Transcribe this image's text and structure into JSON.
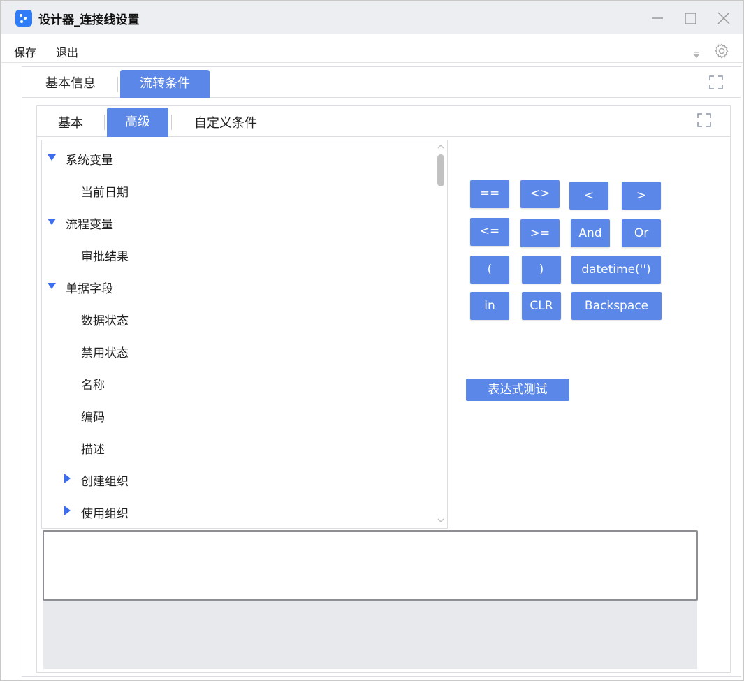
{
  "window": {
    "title": "设计器_连接线设置",
    "controls": [
      "minimize",
      "maximize",
      "close"
    ]
  },
  "menu": {
    "items": [
      "保存",
      "退出"
    ]
  },
  "outer_tabs": [
    {
      "label": "基本信息",
      "active": false
    },
    {
      "label": "流转条件",
      "active": true
    }
  ],
  "inner_tabs": [
    {
      "label": "基本",
      "active": false
    },
    {
      "label": "高级",
      "active": true
    },
    {
      "label": "自定义条件",
      "active": false
    }
  ],
  "tree": {
    "groups": [
      {
        "label": "系统变量",
        "expanded": true,
        "children": [
          "当前日期"
        ]
      },
      {
        "label": "流程变量",
        "expanded": true,
        "children": [
          "审批结果"
        ]
      },
      {
        "label": "单据字段",
        "expanded": true,
        "children": [
          "数据状态",
          "禁用状态",
          "名称",
          "编码",
          "描述"
        ],
        "collapsed_children": [
          "创建组织",
          "使用组织"
        ]
      }
    ]
  },
  "operators": [
    [
      "==",
      "<>",
      "<",
      ">"
    ],
    [
      "<=",
      ">=",
      "And",
      "Or"
    ],
    [
      "(",
      ")",
      "datetime('')"
    ],
    [
      "in",
      "CLR",
      "Backspace"
    ]
  ],
  "test_button": "表达式测试",
  "expression": "",
  "colors": {
    "accent": "#5b87e8",
    "caret": "#3d6ef0",
    "titlebar": "#eceef2",
    "gray_area": "#e8e9ec"
  }
}
